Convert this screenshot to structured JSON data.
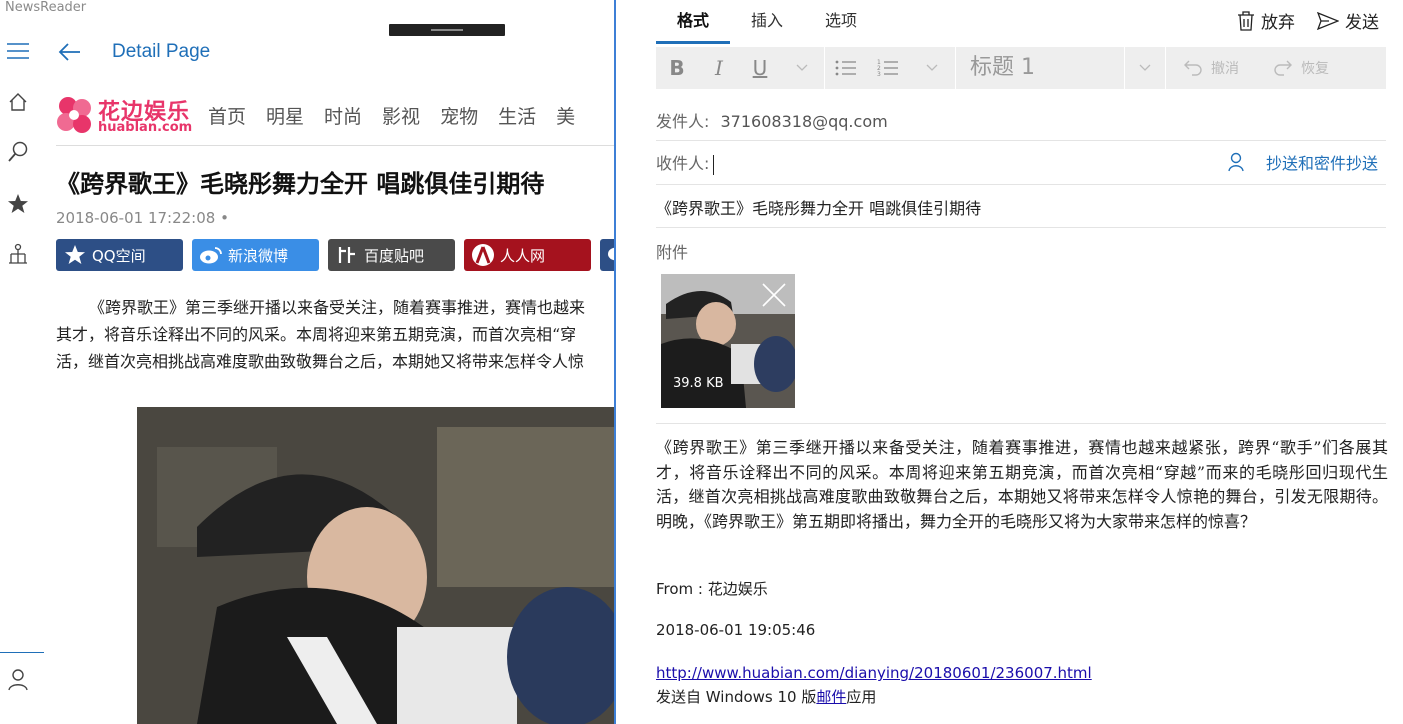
{
  "app": {
    "title": "NewsReader"
  },
  "left": {
    "page_title": "Detail Page",
    "brand": {
      "cn": "花边娱乐",
      "en": "huablan.com"
    },
    "brand_nav": [
      "首页",
      "明星",
      "时尚",
      "影视",
      "宠物",
      "生活",
      "美"
    ],
    "article": {
      "title": "《跨界歌王》毛晓彤舞力全开 唱跳俱佳引期待",
      "date": "2018-06-01 17:22:08 •",
      "share": [
        {
          "label": "QQ空间",
          "icon": "star-icon",
          "color": "#2d4f86"
        },
        {
          "label": "新浪微博",
          "icon": "weibo-icon",
          "color": "#3a8ee6"
        },
        {
          "label": "百度贴吧",
          "icon": "tieba-icon",
          "color": "#4a4a4a"
        },
        {
          "label": "人人网",
          "icon": "renren-icon",
          "color": "#a5121e"
        },
        {
          "label": "",
          "icon": "wechat-icon",
          "color": "#2d4f86"
        }
      ],
      "body_lines": [
        "《跨界歌王》第三季继开播以来备受关注，随着赛事推进，赛情也越来",
        "其才，将音乐诠释出不同的风采。本周将迎来第五期竞演，而首次亮相“穿",
        "活，继首次亮相挑战高难度歌曲致敬舞台之后，本期她又将带来怎样令人惊"
      ]
    }
  },
  "mail": {
    "tabs": [
      "格式",
      "插入",
      "选项"
    ],
    "active_tab": "格式",
    "discard_label": "放弃",
    "send_label": "发送",
    "toolbar": {
      "bold": "B",
      "italic": "I",
      "underline": "U",
      "heading": "标题 1",
      "undo": "撤消",
      "redo": "恢复"
    },
    "from_label": "发件人:",
    "from_value": "371608318@qq.com",
    "to_label": "收件人:",
    "to_value": "",
    "cc_label": "抄送和密件抄送",
    "subject": "《跨界歌王》毛晓彤舞力全开 唱跳俱佳引期待",
    "attachments_label": "附件",
    "attachment": {
      "size": "39.8 KB"
    },
    "body": "《跨界歌王》第三季继开播以来备受关注，随着赛事推进，赛情也越来越紧张，跨界“歌手”们各展其才，将音乐诠释出不同的风采。本周将迎来第五期竞演，而首次亮相“穿越”而来的毛晓彤回归现代生活，继首次亮相挑战高难度歌曲致敬舞台之后，本期她又将带来怎样令人惊艳的舞台，引发无限期待。明晚，《跨界歌王》第五期即将播出，舞力全开的毛晓彤又将为大家带来怎样的惊喜？",
    "from_source": "From : 花边娱乐",
    "sent_time": "2018-06-01 19:05:46",
    "link": "http://www.huabian.com/dianying/20180601/236007.html",
    "footer_prefix": "发送自 Windows 10 版",
    "footer_link": "邮件",
    "footer_suffix": "应用"
  },
  "colors": {
    "accent": "#1f6fb8",
    "brand": "#e8356a",
    "divider": "#3d7fd6"
  }
}
